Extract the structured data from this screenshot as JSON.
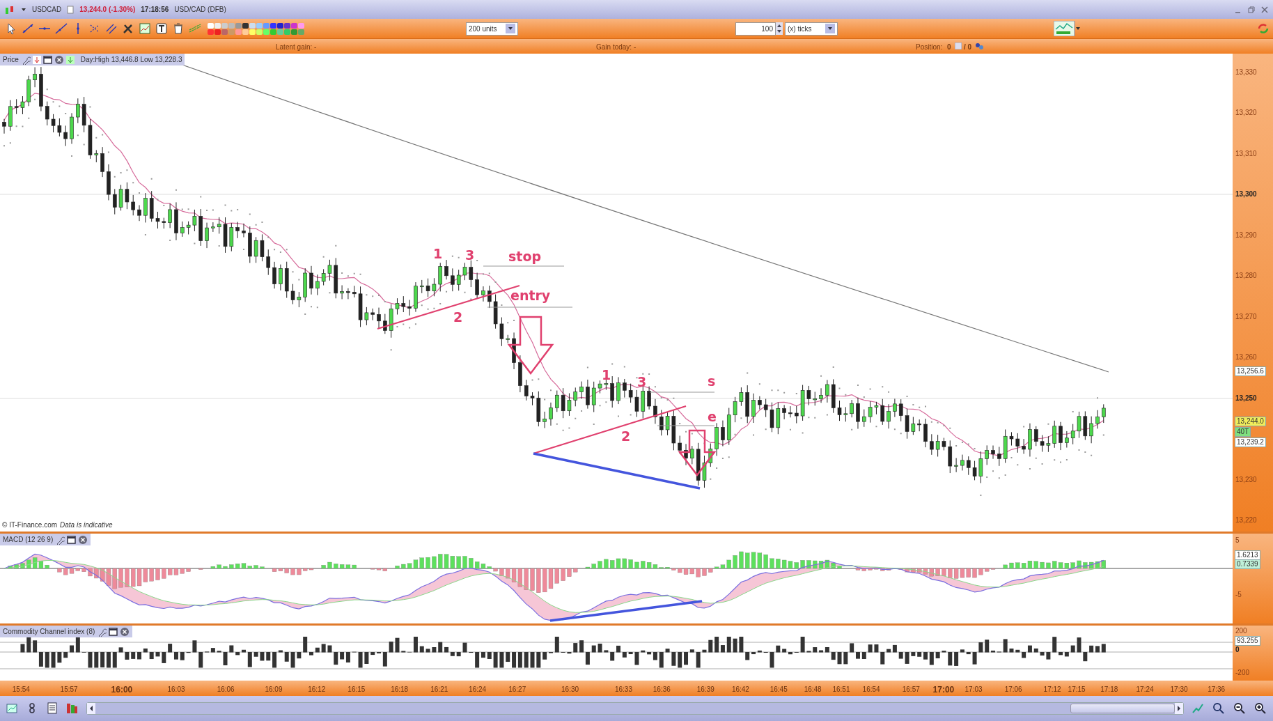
{
  "window": {
    "title": "USDCAD",
    "price": "13,244.0 (-1.30%)",
    "time": "17:18:56",
    "instrument": "USD/CAD (DFB)"
  },
  "toolbar": {
    "units": "200 units",
    "ticks_value": "100",
    "ticks_unit": "(x) ticks"
  },
  "status": {
    "latent_gain": "Latent gain: -",
    "gain_today": "Gain today: -",
    "position_label": "Position:",
    "position_value": "0",
    "position_total": "/ 0"
  },
  "price_panel": {
    "title": "Price",
    "day_range": "Day:High 13,446.8 Low 13,228.3",
    "credit": "© IT-Finance.com",
    "disclaimer": "Data is indicative",
    "annotations": [
      {
        "text": "1"
      },
      {
        "text": "3"
      },
      {
        "text": "stop"
      },
      {
        "text": "2"
      },
      {
        "text": "entry"
      },
      {
        "text": "1"
      },
      {
        "text": "3"
      },
      {
        "text": "s"
      },
      {
        "text": "2"
      },
      {
        "text": "e"
      }
    ],
    "y_labels": [
      {
        "text": "13,330",
        "bold": false
      },
      {
        "text": "13,320",
        "bold": false
      },
      {
        "text": "13,310",
        "bold": false
      },
      {
        "text": "13,300",
        "bold": true
      },
      {
        "text": "13,290",
        "bold": false
      },
      {
        "text": "13,280",
        "bold": false
      },
      {
        "text": "13,270",
        "bold": false
      },
      {
        "text": "13,260",
        "bold": false
      },
      {
        "text": "13,250",
        "bold": true
      },
      {
        "text": "13,230",
        "bold": false
      },
      {
        "text": "13,220",
        "bold": false
      }
    ],
    "badges": [
      {
        "text": "13,256.6",
        "color": "#ffffff"
      },
      {
        "text": "13,244.0",
        "color": "#f2ee5a"
      },
      {
        "text": "40T",
        "color": "#7fe07f"
      },
      {
        "text": "13,239.2",
        "color": "#ffffff"
      }
    ]
  },
  "macd_panel": {
    "title": "MACD (12 26 9)",
    "y_labels": [
      "5",
      "-5"
    ],
    "badges": [
      {
        "text": "1.6213",
        "color": "#ffffff"
      },
      {
        "text": "0.7339",
        "color": "#bff0d8"
      }
    ]
  },
  "cci_panel": {
    "title": "Commodity Channel index (8)",
    "y_labels": [
      "200",
      "0",
      "-200"
    ],
    "badges": [
      {
        "text": "93.255",
        "color": "#ffffff"
      }
    ]
  },
  "time_axis": [
    {
      "text": "15:54",
      "bold": false
    },
    {
      "text": "15:57",
      "bold": false
    },
    {
      "text": "16:00",
      "bold": true
    },
    {
      "text": "16:03",
      "bold": false
    },
    {
      "text": "16:06",
      "bold": false
    },
    {
      "text": "16:09",
      "bold": false
    },
    {
      "text": "16:12",
      "bold": false
    },
    {
      "text": "16:15",
      "bold": false
    },
    {
      "text": "16:18",
      "bold": false
    },
    {
      "text": "16:21",
      "bold": false
    },
    {
      "text": "16:24",
      "bold": false
    },
    {
      "text": "16:27",
      "bold": false
    },
    {
      "text": "16:30",
      "bold": false
    },
    {
      "text": "16:33",
      "bold": false
    },
    {
      "text": "16:36",
      "bold": false
    },
    {
      "text": "16:39",
      "bold": false
    },
    {
      "text": "16:42",
      "bold": false
    },
    {
      "text": "16:45",
      "bold": false
    },
    {
      "text": "16:48",
      "bold": false
    },
    {
      "text": "16:51",
      "bold": false
    },
    {
      "text": "16:54",
      "bold": false
    },
    {
      "text": "16:57",
      "bold": false
    },
    {
      "text": "17:00",
      "bold": true
    },
    {
      "text": "17:03",
      "bold": false
    },
    {
      "text": "17:06",
      "bold": false
    },
    {
      "text": "17:12",
      "bold": false
    },
    {
      "text": "17:15",
      "bold": false
    },
    {
      "text": "17:18",
      "bold": false
    },
    {
      "text": "17:24",
      "bold": false
    },
    {
      "text": "17:30",
      "bold": false
    },
    {
      "text": "17:36",
      "bold": false
    }
  ]
}
